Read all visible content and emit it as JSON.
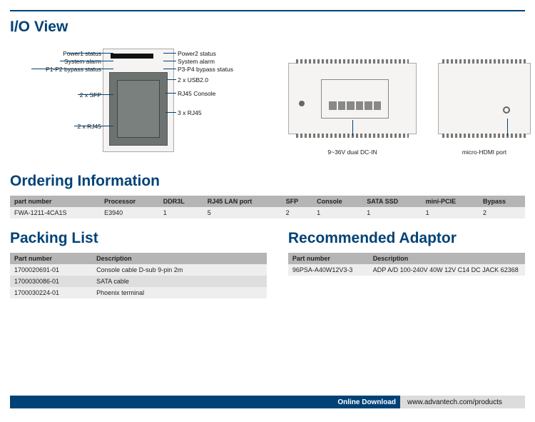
{
  "sections": {
    "io_view": "I/O View",
    "ordering": "Ordering Information",
    "packing": "Packing List",
    "adaptor": "Recommended Adaptor"
  },
  "io_view": {
    "front": {
      "left": [
        "Power1 status",
        "System alarm",
        "P1-P2 bypass status",
        "2 x SFP",
        "2 x RJ45"
      ],
      "right": [
        "Power2 status",
        "System alarm",
        "P3-P4 bypass status",
        "2 x USB2.0",
        "RJ45 Console",
        "3 x RJ45"
      ]
    },
    "top_caption": "9~36V dual DC-IN",
    "side_caption": "micro-HDMI port"
  },
  "ordering": {
    "headers": [
      "part number",
      "Processor",
      "DDR3L",
      "RJ45 LAN port",
      "SFP",
      "Console",
      "SATA SSD",
      "mini-PCIE",
      "Bypass"
    ],
    "rows": [
      [
        "FWA-1211-4CA1S",
        "E3940",
        "1",
        "5",
        "2",
        "1",
        "1",
        "1",
        "2"
      ]
    ]
  },
  "packing": {
    "headers": [
      "Part number",
      "Description"
    ],
    "rows": [
      [
        "1700020691-01",
        "Console cable D-sub 9-pin 2m"
      ],
      [
        "1700030086-01",
        "SATA cable"
      ],
      [
        "1700030224-01",
        "Phoenix terminal"
      ]
    ]
  },
  "adaptor": {
    "headers": [
      "Part number",
      "Description"
    ],
    "rows": [
      [
        "96PSA-A40W12V3-3",
        "ADP A/D 100-240V 40W 12V C14 DC JACK 62368"
      ]
    ]
  },
  "footer": {
    "label": "Online Download",
    "url": "www.advantech.com/products"
  }
}
